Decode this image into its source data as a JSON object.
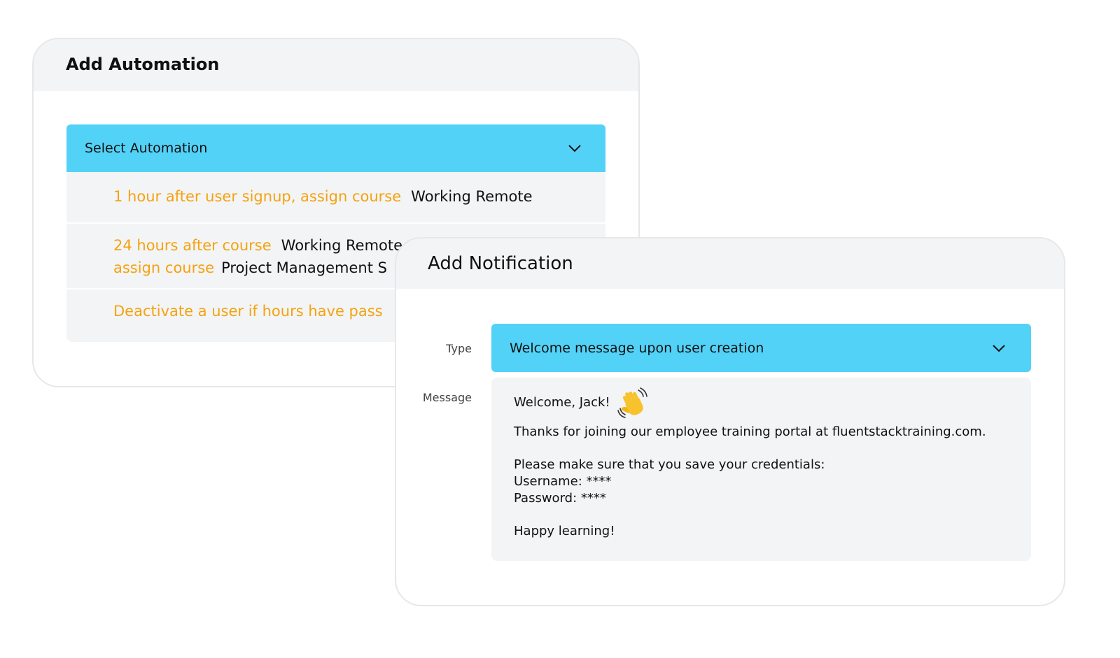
{
  "automation": {
    "title": "Add Automation",
    "select_label": "Select Automation",
    "options": [
      {
        "line1_key": "1 hour after user signup, assign course",
        "line1_value": "Working Remote"
      },
      {
        "line1_key": "24 hours after course",
        "line1_value": "Working Remote",
        "line2_key": "assign course",
        "line2_value": "Project Management S"
      },
      {
        "line1_key": "Deactivate a user if hours have pass"
      }
    ]
  },
  "notification": {
    "title": "Add Notification",
    "type_label": "Type",
    "type_value": "Welcome message upon user creation",
    "message_label": "Message",
    "message": {
      "greeting": "Welcome, Jack!",
      "greeting_icon": "waving-hand-icon",
      "line_thanks": "Thanks for joining our employee training portal at fluentstacktraining.com.",
      "line_credentials": "Please make sure that you save your credentials:",
      "line_username": "Username: ****",
      "line_password": "Password: ****",
      "line_closing": "Happy learning!"
    }
  },
  "colors": {
    "accent": "#53d2f8",
    "orange_text": "#f5a20f",
    "panel_bg": "#f3f4f5"
  }
}
